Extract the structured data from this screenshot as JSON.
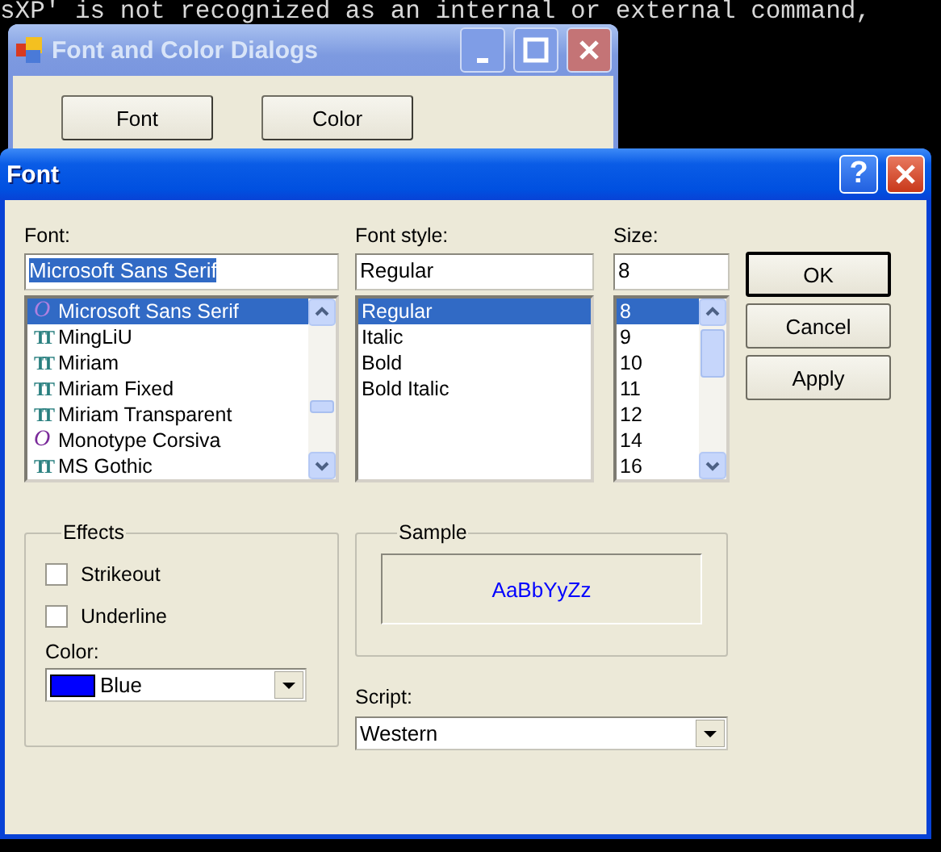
{
  "console": {
    "lines": [
      "sXP' is not recognized as an internal or external command,"
    ]
  },
  "back_window": {
    "title": "Font and Color Dialogs",
    "active": false,
    "buttons": [
      "Font",
      "Color"
    ]
  },
  "dialog": {
    "title": "Font",
    "active": true,
    "help_button": "?",
    "font": {
      "label": "Font:",
      "value": "Microsoft Sans Serif",
      "value_selected": true,
      "items": [
        {
          "name": "Microsoft Sans Serif",
          "kind": "opentype",
          "icon": "O",
          "selected": true
        },
        {
          "name": "MingLiU",
          "kind": "truetype",
          "icon": "TT",
          "selected": false
        },
        {
          "name": "Miriam",
          "kind": "truetype",
          "icon": "TT",
          "selected": false
        },
        {
          "name": "Miriam Fixed",
          "kind": "truetype",
          "icon": "TT",
          "selected": false
        },
        {
          "name": "Miriam Transparent",
          "kind": "truetype",
          "icon": "TT",
          "selected": false
        },
        {
          "name": "Monotype Corsiva",
          "kind": "opentype",
          "icon": "O",
          "selected": false
        },
        {
          "name": "MS Gothic",
          "kind": "truetype",
          "icon": "TT",
          "selected": false
        }
      ]
    },
    "style": {
      "label": "Font style:",
      "value": "Regular",
      "value_selected": false,
      "items": [
        {
          "name": "Regular",
          "selected": true
        },
        {
          "name": "Italic",
          "selected": false
        },
        {
          "name": "Bold",
          "selected": false
        },
        {
          "name": "Bold Italic",
          "selected": false
        }
      ]
    },
    "size": {
      "label": "Size:",
      "value": "8",
      "value_selected": false,
      "items": [
        {
          "name": "8",
          "selected": true
        },
        {
          "name": "9",
          "selected": false
        },
        {
          "name": "10",
          "selected": false
        },
        {
          "name": "11",
          "selected": false
        },
        {
          "name": "12",
          "selected": false
        },
        {
          "name": "14",
          "selected": false
        },
        {
          "name": "16",
          "selected": false
        }
      ]
    },
    "buttons": [
      {
        "label": "OK",
        "default": true
      },
      {
        "label": "Cancel",
        "default": false
      },
      {
        "label": "Apply",
        "default": false
      }
    ],
    "effects": {
      "title": "Effects",
      "options": [
        {
          "label": "Strikeout",
          "checked": false
        },
        {
          "label": "Underline",
          "checked": false
        }
      ],
      "color_label": "Color:",
      "color": {
        "name": "Blue",
        "color": "#0000ff"
      }
    },
    "sample": {
      "title": "Sample",
      "text": "AaBbYyZz"
    },
    "script": {
      "label": "Script:",
      "value": "Western"
    }
  }
}
